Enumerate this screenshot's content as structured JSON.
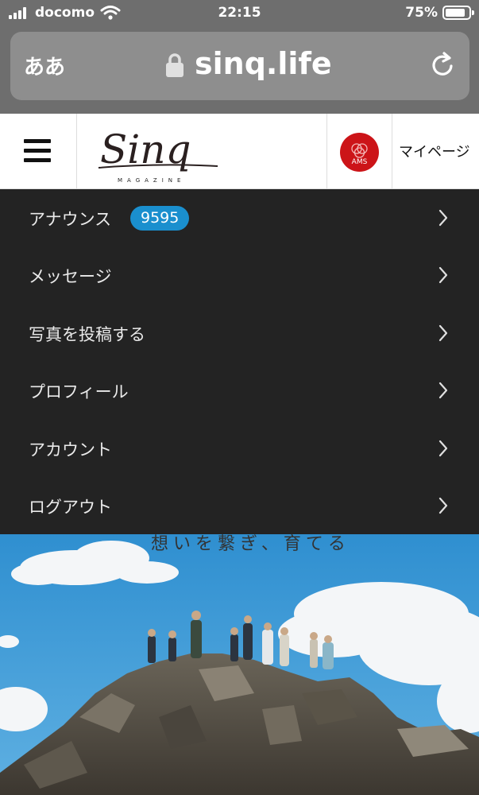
{
  "status_bar": {
    "carrier": "docomo",
    "time": "22:15",
    "battery": "75%"
  },
  "address_bar": {
    "text_size_label": "ああ",
    "url": "sinq.life"
  },
  "header": {
    "logo_text": "Sinq",
    "logo_sub": "MAGAZINE",
    "avatar_label": "AMS",
    "mypage": "マイページ"
  },
  "menu": {
    "items": [
      {
        "label": "アナウンス",
        "badge": "9595"
      },
      {
        "label": "メッセージ"
      },
      {
        "label": "写真を投稿する"
      },
      {
        "label": "プロフィール"
      },
      {
        "label": "アカウント"
      },
      {
        "label": "ログアウト"
      }
    ]
  },
  "hero": {
    "caption": "想いを繋ぎ、育てる"
  },
  "colors": {
    "badge": "#1a8fce",
    "avatar": "#cc1418",
    "menu_bg": "#232323"
  }
}
